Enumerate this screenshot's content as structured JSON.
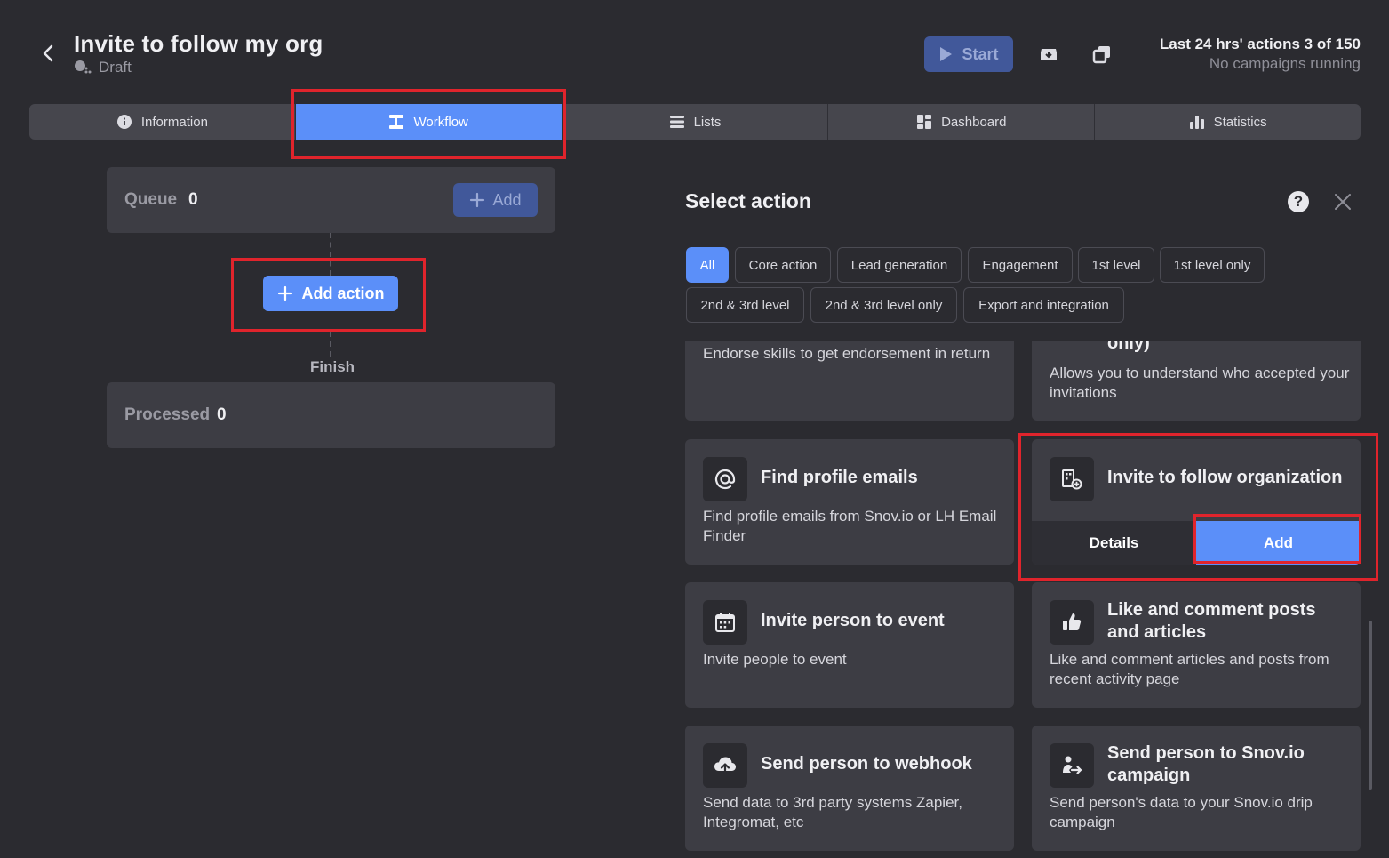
{
  "header": {
    "title": "Invite to follow my org",
    "status": "Draft",
    "start_label": "Start",
    "quota_main": "Last 24 hrs' actions 3 of 150",
    "quota_sub": "No campaigns running"
  },
  "tabs": [
    {
      "label": "Information",
      "icon": "info-icon"
    },
    {
      "label": "Workflow",
      "icon": "workflow-icon",
      "active": true
    },
    {
      "label": "Lists",
      "icon": "list-icon"
    },
    {
      "label": "Dashboard",
      "icon": "dashboard-icon"
    },
    {
      "label": "Statistics",
      "icon": "bar-chart-icon"
    }
  ],
  "workflow": {
    "queue_label": "Queue",
    "queue_count": "0",
    "queue_add_label": "Add",
    "add_action_label": "Add action",
    "finish_label": "Finish",
    "processed_label": "Processed",
    "processed_count": "0"
  },
  "panel": {
    "title": "Select action",
    "filters": [
      "All",
      "Core action",
      "Lead generation",
      "Engagement",
      "1st level",
      "1st level only",
      "2nd & 3rd level",
      "2nd & 3rd level only",
      "Export and integration"
    ],
    "active_filter": "All",
    "cards": [
      {
        "title": "",
        "desc": "Endorse skills to get endorsement in return",
        "icon": ""
      },
      {
        "title": "only)",
        "desc": "Allows you to understand who accepted your invitations",
        "icon": ""
      },
      {
        "title": "Find profile emails",
        "desc": "Find profile emails from Snov.io or LH Email Finder",
        "icon": "at-sign-icon"
      },
      {
        "title": "Invite to follow organization",
        "desc": "",
        "icon": "building-plus-icon",
        "details_label": "Details",
        "add_label": "Add"
      },
      {
        "title": "Invite person to event",
        "desc": "Invite people to event",
        "icon": "calendar-icon"
      },
      {
        "title": "Like and comment posts and articles",
        "desc": "Like and comment articles and posts from recent activity page",
        "icon": "thumbs-up-icon"
      },
      {
        "title": "Send person to webhook",
        "desc": "Send data to 3rd party systems Zapier, Integromat, etc",
        "icon": "cloud-upload-icon"
      },
      {
        "title": "Send person to Snov.io campaign",
        "desc": "Send person's data to your Snov.io drip campaign",
        "icon": "person-send-icon"
      }
    ]
  },
  "colors": {
    "accent": "#5b8ff9",
    "highlight": "#e0242c",
    "background": "#2b2b30",
    "card": "#3d3d44"
  }
}
